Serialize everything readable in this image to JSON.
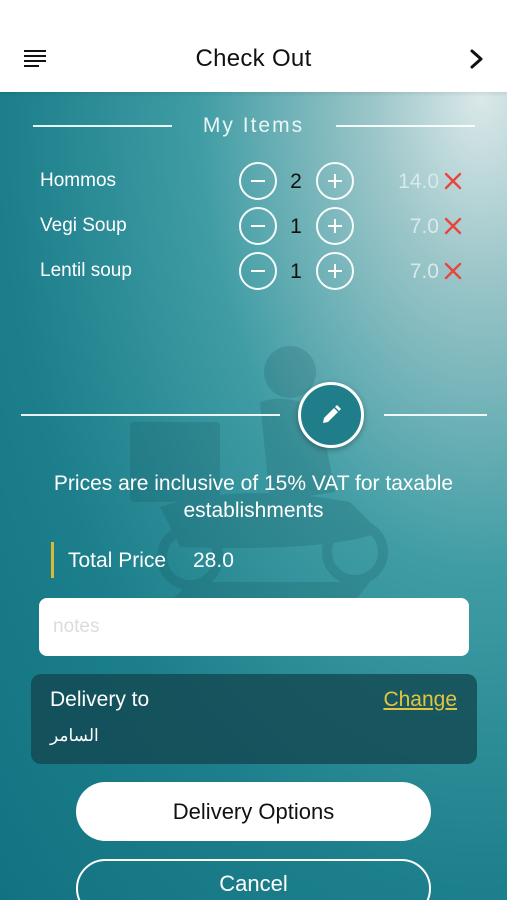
{
  "header": {
    "title": "Check Out",
    "menu_icon": "menu-lines-icon",
    "next_icon": "chevron-right-icon"
  },
  "items_section": {
    "heading": "My Items",
    "items": [
      {
        "name": "Hommos",
        "quantity": "2",
        "price": "14.0"
      },
      {
        "name": "Vegi Soup",
        "quantity": "1",
        "price": "7.0"
      },
      {
        "name": "Lentil soup",
        "quantity": "1",
        "price": "7.0"
      }
    ]
  },
  "vat_note": "Prices are inclusive of 15% VAT for taxable establishments",
  "total": {
    "label": "Total Price",
    "value": "28.0"
  },
  "notes": {
    "placeholder": "notes",
    "value": ""
  },
  "delivery": {
    "label": "Delivery to",
    "change_label": "Change",
    "address": "السامر"
  },
  "buttons": {
    "options_label": "Delivery Options",
    "cancel_label": "Cancel"
  },
  "colors": {
    "accent_gold": "#d9b93a",
    "remove_red": "#e8453c",
    "teal_dark": "#137281",
    "card_bg": "#124650"
  }
}
